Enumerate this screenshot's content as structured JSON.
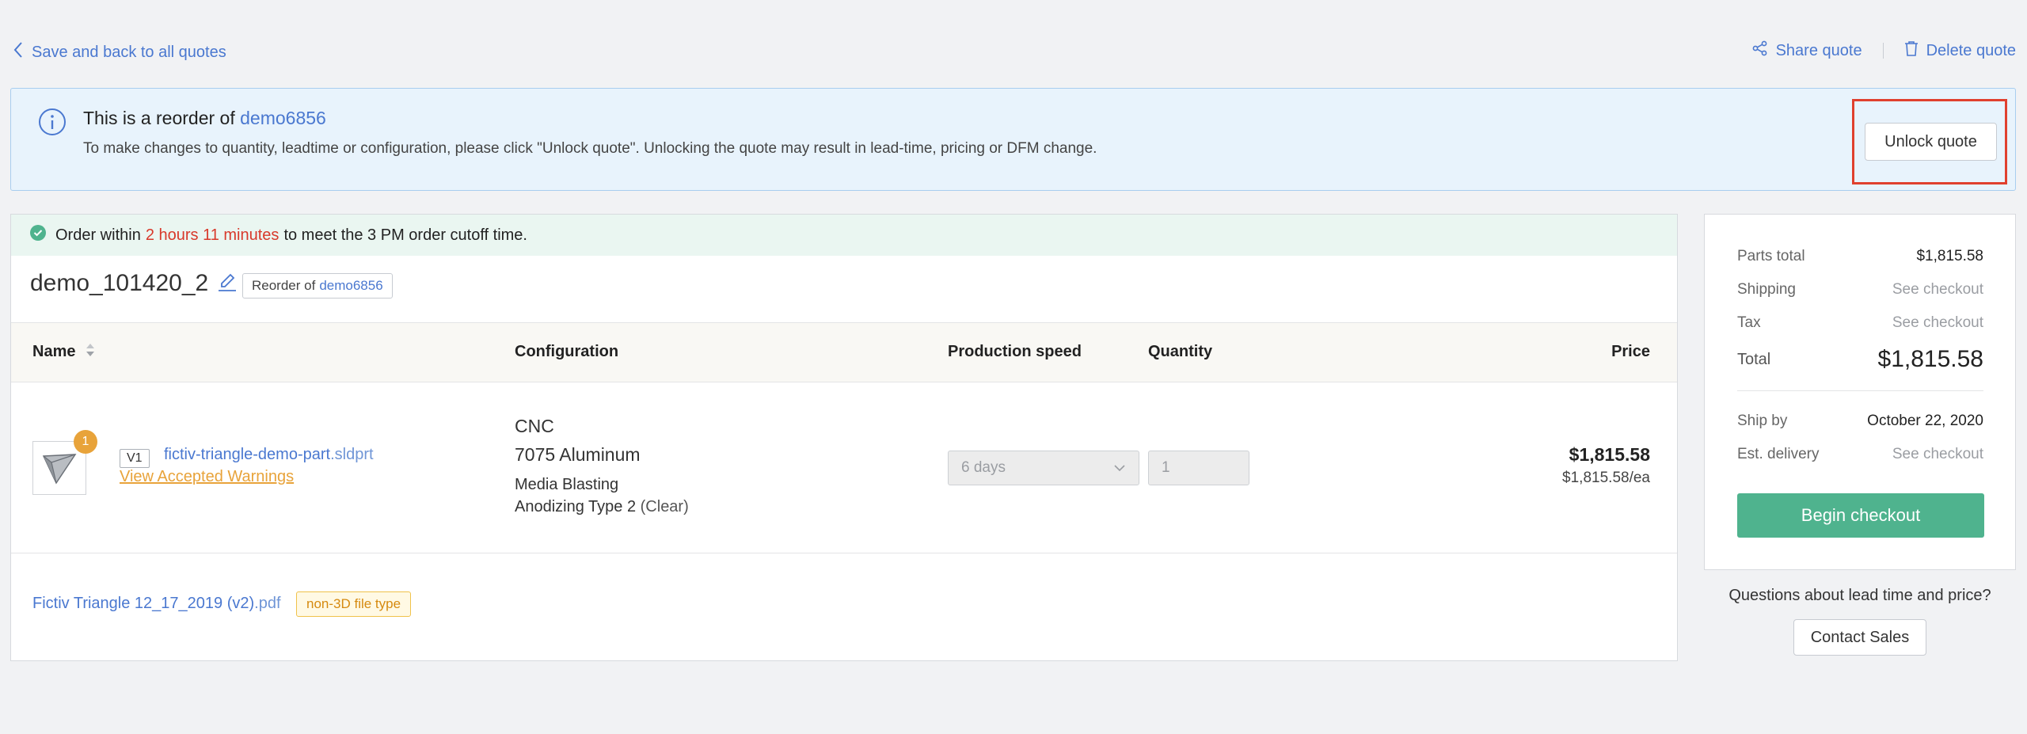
{
  "nav": {
    "back_label": "Save and back to all quotes",
    "share_label": "Share quote",
    "delete_label": "Delete quote"
  },
  "banner": {
    "title_prefix": "This is a reorder of",
    "title_link": "demo6856",
    "description": "To make changes to quantity, leadtime or configuration, please click \"Unlock quote\". Unlocking the quote may result in lead-time, pricing or DFM change.",
    "unlock_label": "Unlock quote"
  },
  "cutoff": {
    "prefix": "Order within",
    "time": "2 hours 11 minutes",
    "suffix": "to meet the 3 PM order cutoff time."
  },
  "quote": {
    "name": "demo_101420_2",
    "reorder_prefix": "Reorder of",
    "reorder_link": "demo6856"
  },
  "table": {
    "headers": {
      "name": "Name",
      "configuration": "Configuration",
      "production_speed": "Production speed",
      "quantity": "Quantity",
      "price": "Price"
    },
    "part": {
      "badge": "1",
      "version": "V1",
      "file_base": "fictiv-triangle-demo-part",
      "file_ext": ".sldprt",
      "warnings_link": "View Accepted Warnings",
      "process": "CNC",
      "material": "7075 Aluminum",
      "finish1": "Media Blasting",
      "finish2": "Anodizing Type 2",
      "finish2_note": "(Clear)",
      "speed": "6 days",
      "quantity": "1",
      "price_total": "$1,815.58",
      "price_each": "$1,815.58/ea"
    },
    "attachment": {
      "file_base": "Fictiv Triangle 12_17_2019 (v2)",
      "file_ext": ".pdf",
      "tag": "non-3D file type"
    }
  },
  "summary": {
    "parts_total_label": "Parts total",
    "parts_total_value": "$1,815.58",
    "shipping_label": "Shipping",
    "shipping_value": "See checkout",
    "tax_label": "Tax",
    "tax_value": "See checkout",
    "total_label": "Total",
    "total_value": "$1,815.58",
    "ship_by_label": "Ship by",
    "ship_by_value": "October 22, 2020",
    "delivery_label": "Est. delivery",
    "delivery_value": "See checkout",
    "checkout_label": "Begin checkout"
  },
  "help": {
    "question": "Questions about lead time and price?",
    "contact_label": "Contact Sales"
  },
  "colors": {
    "link": "#4a78d0",
    "accent_green": "#4fb38e",
    "warning_orange": "#e8a33a",
    "highlight_red": "#e0402e"
  }
}
